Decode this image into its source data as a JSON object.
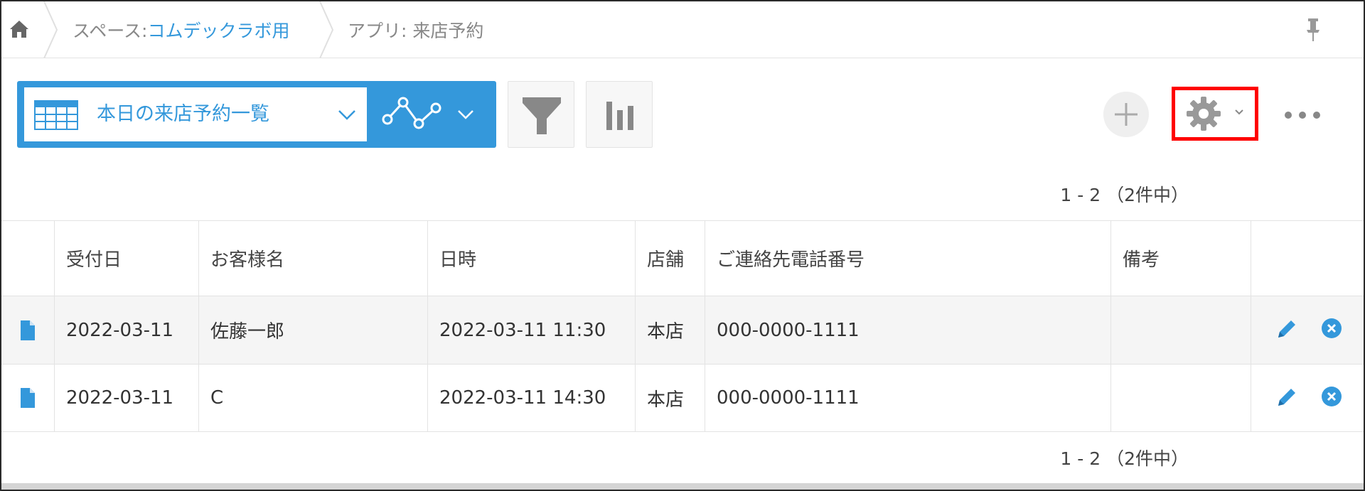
{
  "breadcrumb": {
    "home_icon": "home-icon",
    "space_prefix": "スペース: ",
    "space_name": "コムデックラボ用",
    "app_label": "アプリ: 来店予約",
    "pin_icon": "pin-icon"
  },
  "toolbar": {
    "view_icon": "table-view-icon",
    "view_name": "本日の来店予約一覧",
    "graph_icon": "graph-icon",
    "filter_icon": "filter-icon",
    "chart_icon": "bar-chart-icon",
    "add_icon": "plus-icon",
    "settings_icon": "gear-icon",
    "more_icon": "more-icon",
    "highlight_color": "#ff0000",
    "accent_color": "#3498db"
  },
  "pager": {
    "top": "1 - 2 （2件中）",
    "bottom": "1 - 2 （2件中）"
  },
  "table": {
    "columns": [
      "受付日",
      "お客様名",
      "日時",
      "店舗",
      "ご連絡先電話番号",
      "備考"
    ],
    "rows": [
      {
        "received": "2022-03-11",
        "customer": "佐藤一郎",
        "datetime": "2022-03-11 11:30",
        "store": "本店",
        "phone": "000-0000-1111",
        "note": ""
      },
      {
        "received": "2022-03-11",
        "customer": "C",
        "datetime": "2022-03-11 14:30",
        "store": "本店",
        "phone": "000-0000-1111",
        "note": ""
      }
    ]
  }
}
